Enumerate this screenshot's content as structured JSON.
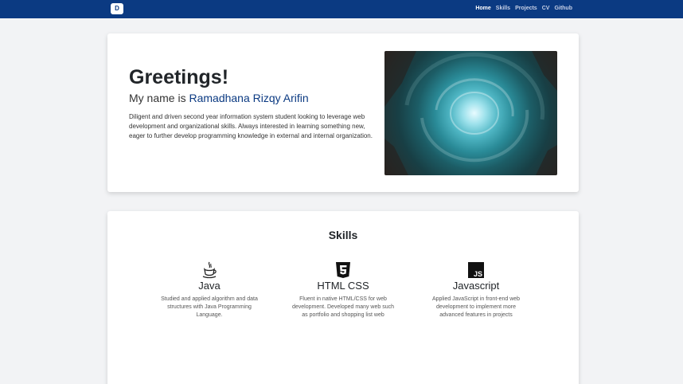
{
  "navbar": {
    "brand": "D",
    "links": [
      "Home",
      "Skills",
      "Projects",
      "CV",
      "Github"
    ]
  },
  "hero": {
    "greeting": "Greetings!",
    "intro_prefix": "My name is ",
    "name": "Ramadhana Rizqy Arifin",
    "bio": "Diligent and driven second year information system student looking to leverage web development and organizational skills. Always interested in learning something new, eager to further develop programming knowledge in external and internal organization."
  },
  "skills": {
    "title": "Skills",
    "items": [
      {
        "name": "Java",
        "icon": "java-icon",
        "description": "Studied and applied algorithm and data structures with Java Programming Language."
      },
      {
        "name": "HTML CSS",
        "icon": "html5-icon",
        "description": "Fluent in native HTML/CSS for web development. Developed many web such as portfolio and shopping list web"
      },
      {
        "name": "Javascript",
        "icon": "js-icon",
        "description": "Applied JavaScript in front-end web development to implement more advanced features in projects"
      }
    ]
  },
  "colors": {
    "navbar": "#0b3a82",
    "accent": "#0b3a82",
    "background": "#f2f3f5"
  }
}
